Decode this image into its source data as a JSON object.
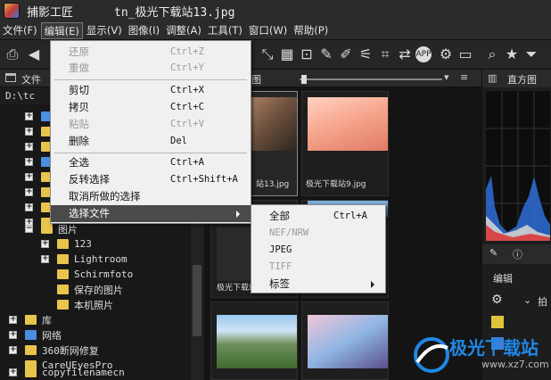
{
  "window": {
    "app_name": "捕影工匠",
    "file_name": "tn_极光下载站13.jpg"
  },
  "menubar": [
    {
      "label": "文件(F)"
    },
    {
      "label": "编辑(E)"
    },
    {
      "label": "显示(V)"
    },
    {
      "label": "图像(I)"
    },
    {
      "label": "调整(A)"
    },
    {
      "label": "工具(T)"
    },
    {
      "label": "窗口(W)"
    },
    {
      "label": "帮助(P)"
    }
  ],
  "left_panel": {
    "header": "文件",
    "path": "D:\\tc",
    "tree": [
      {
        "label": "图片",
        "expander": "−"
      },
      {
        "label": "123",
        "expander": "+"
      },
      {
        "label": "Lightroom",
        "expander": "+"
      },
      {
        "label": "Schirmfoto",
        "expander": ""
      },
      {
        "label": "保存的图片",
        "expander": ""
      },
      {
        "label": "本机照片",
        "expander": ""
      },
      {
        "label": "库",
        "expander": "+"
      },
      {
        "label": "网络",
        "expander": "+"
      },
      {
        "label": "360断网修复",
        "expander": "+"
      },
      {
        "label": "CareUEyesPro",
        "expander": ""
      },
      {
        "label": "copyfilenamecn",
        "expander": "+"
      }
    ]
  },
  "center_panel": {
    "header_fragment": "图",
    "thumbnails": [
      {
        "caption": "站13.jpg"
      },
      {
        "caption": "极光下载站9.jpg"
      },
      {
        "caption": "极光下载站"
      },
      {
        "caption": ""
      },
      {
        "caption": ""
      },
      {
        "caption": ""
      }
    ]
  },
  "right_panel": {
    "histogram_title": "直方图",
    "edit_label": "编辑",
    "shoot_label": "拍"
  },
  "edit_menu": {
    "items": [
      {
        "label": "还原",
        "shortcut": "Ctrl+Z",
        "enabled": false
      },
      {
        "label": "重做",
        "shortcut": "Ctrl+Y",
        "enabled": false
      },
      {
        "label": "剪切",
        "shortcut": "Ctrl+X",
        "enabled": true
      },
      {
        "label": "拷贝",
        "shortcut": "Ctrl+C",
        "enabled": true
      },
      {
        "label": "粘贴",
        "shortcut": "Ctrl+V",
        "enabled": false
      },
      {
        "label": "删除",
        "shortcut": "Del",
        "enabled": true
      },
      {
        "label": "全选",
        "shortcut": "Ctrl+A",
        "enabled": true
      },
      {
        "label": "反转选择",
        "shortcut": "Ctrl+Shift+A",
        "enabled": true
      },
      {
        "label": "取消所做的选择",
        "shortcut": "",
        "enabled": true
      },
      {
        "label": "选择文件",
        "shortcut": "",
        "enabled": true,
        "highlighted": true,
        "submenu": true
      }
    ]
  },
  "select_file_submenu": {
    "items": [
      {
        "label": "全部",
        "shortcut": "Ctrl+A",
        "enabled": true
      },
      {
        "label": "NEF/NRW",
        "shortcut": "",
        "enabled": false
      },
      {
        "label": "JPEG",
        "shortcut": "",
        "enabled": true
      },
      {
        "label": "TIFF",
        "shortcut": "",
        "enabled": false
      },
      {
        "label": "标签",
        "shortcut": "",
        "enabled": true,
        "submenu": true
      }
    ]
  },
  "watermark": {
    "text_cn": "极光下载站",
    "text_url": "www.xz7.com"
  },
  "colors": {
    "menu_bg": "#f0f0f0",
    "menu_highlight": "#4a4a4a",
    "dark_bg": "#1b1b1b",
    "folder": "#e9c44c"
  }
}
